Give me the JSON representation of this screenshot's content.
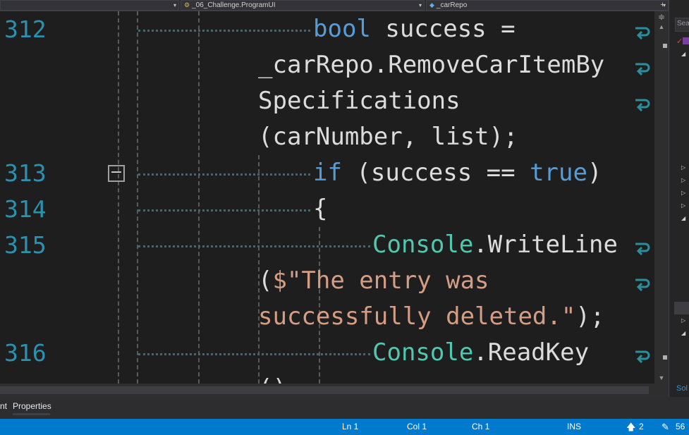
{
  "nav": {
    "project_dropdown": "",
    "class_dropdown": "_06_Challenge.ProgramUI",
    "member_dropdown": "_carRepo",
    "add_icon": "+",
    "dropdown_arrow": "▾"
  },
  "editor": {
    "lines": [
      {
        "number": "312",
        "segments": [
          [
            "bool",
            "kw"
          ],
          [
            " success =",
            ""
          ]
        ]
      },
      {
        "number": "",
        "segments": [
          [
            "_carRepo.RemoveCarItemBy",
            ""
          ]
        ]
      },
      {
        "number": "",
        "segments": [
          [
            "Specifications",
            ""
          ]
        ]
      },
      {
        "number": "",
        "segments": [
          [
            "(carNumber, list);",
            ""
          ]
        ]
      },
      {
        "number": "313",
        "segments": [
          [
            "if",
            "kw"
          ],
          [
            " (success == ",
            ""
          ],
          [
            "true",
            "kw"
          ],
          [
            ")",
            ""
          ]
        ]
      },
      {
        "number": "314",
        "segments": [
          [
            "{",
            ""
          ]
        ]
      },
      {
        "number": "315",
        "segments": [
          [
            "Console",
            "ty"
          ],
          [
            ".WriteLine",
            ""
          ]
        ]
      },
      {
        "number": "",
        "segments": [
          [
            "(",
            ""
          ],
          [
            "$\"The entry was",
            "st"
          ]
        ]
      },
      {
        "number": "",
        "segments": [
          [
            "successfully deleted.\"",
            "st"
          ],
          [
            ");",
            ""
          ]
        ]
      },
      {
        "number": "316",
        "segments": [
          [
            "Console",
            "ty"
          ],
          [
            ".ReadKey",
            ""
          ]
        ]
      },
      {
        "number": "",
        "segments": [
          [
            "();",
            ""
          ]
        ]
      }
    ],
    "fold_symbol": "−"
  },
  "colors": {
    "keyword": "#569cd6",
    "type": "#4ec9b0",
    "string": "#d69d85",
    "line_number": "#2b91af",
    "status_bar": "#007acc"
  },
  "right_panel": {
    "search_text": "Sea",
    "solution_label": "Sol"
  },
  "bottom_tabs": {
    "left_label": "nt",
    "properties_label": "Properties"
  },
  "status": {
    "ln": "Ln 1",
    "col": "Col 1",
    "ch": "Ch 1",
    "mode": "INS",
    "up_icon": "🡅",
    "up_count": "2",
    "pencil_icon": "✎",
    "pencil_count": "56"
  },
  "icons": {
    "wrap": "word-wrap-glyph-icon",
    "class": "class-icon",
    "field": "field-icon"
  }
}
